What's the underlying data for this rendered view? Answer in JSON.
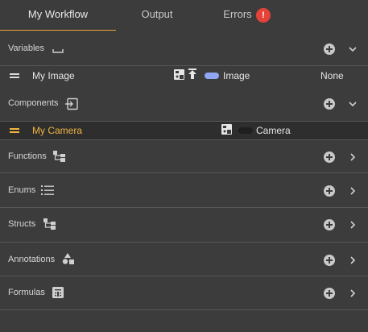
{
  "tabs": [
    {
      "label": "My Workflow",
      "active": true
    },
    {
      "label": "Output",
      "active": false
    },
    {
      "label": "Errors",
      "active": false,
      "badge": "!"
    }
  ],
  "sections": {
    "variables": {
      "title": "Variables",
      "rows": [
        {
          "name": "My Image",
          "type": "Image",
          "default": "None",
          "pill_color": "#8fa7f2"
        }
      ]
    },
    "components": {
      "title": "Components",
      "rows": [
        {
          "name": "My Camera",
          "type": "Camera",
          "pill_color": "#2a2a2a",
          "highlight_color": "#f0b53f"
        }
      ]
    },
    "functions": {
      "title": "Functions"
    },
    "enums": {
      "title": "Enums"
    },
    "structs": {
      "title": "Structs"
    },
    "annotations": {
      "title": "Annotations"
    },
    "formulas": {
      "title": "Formulas"
    }
  },
  "colors": {
    "accent": "#e8a33a",
    "badge": "#e5423a",
    "background": "#3c3c3c"
  }
}
